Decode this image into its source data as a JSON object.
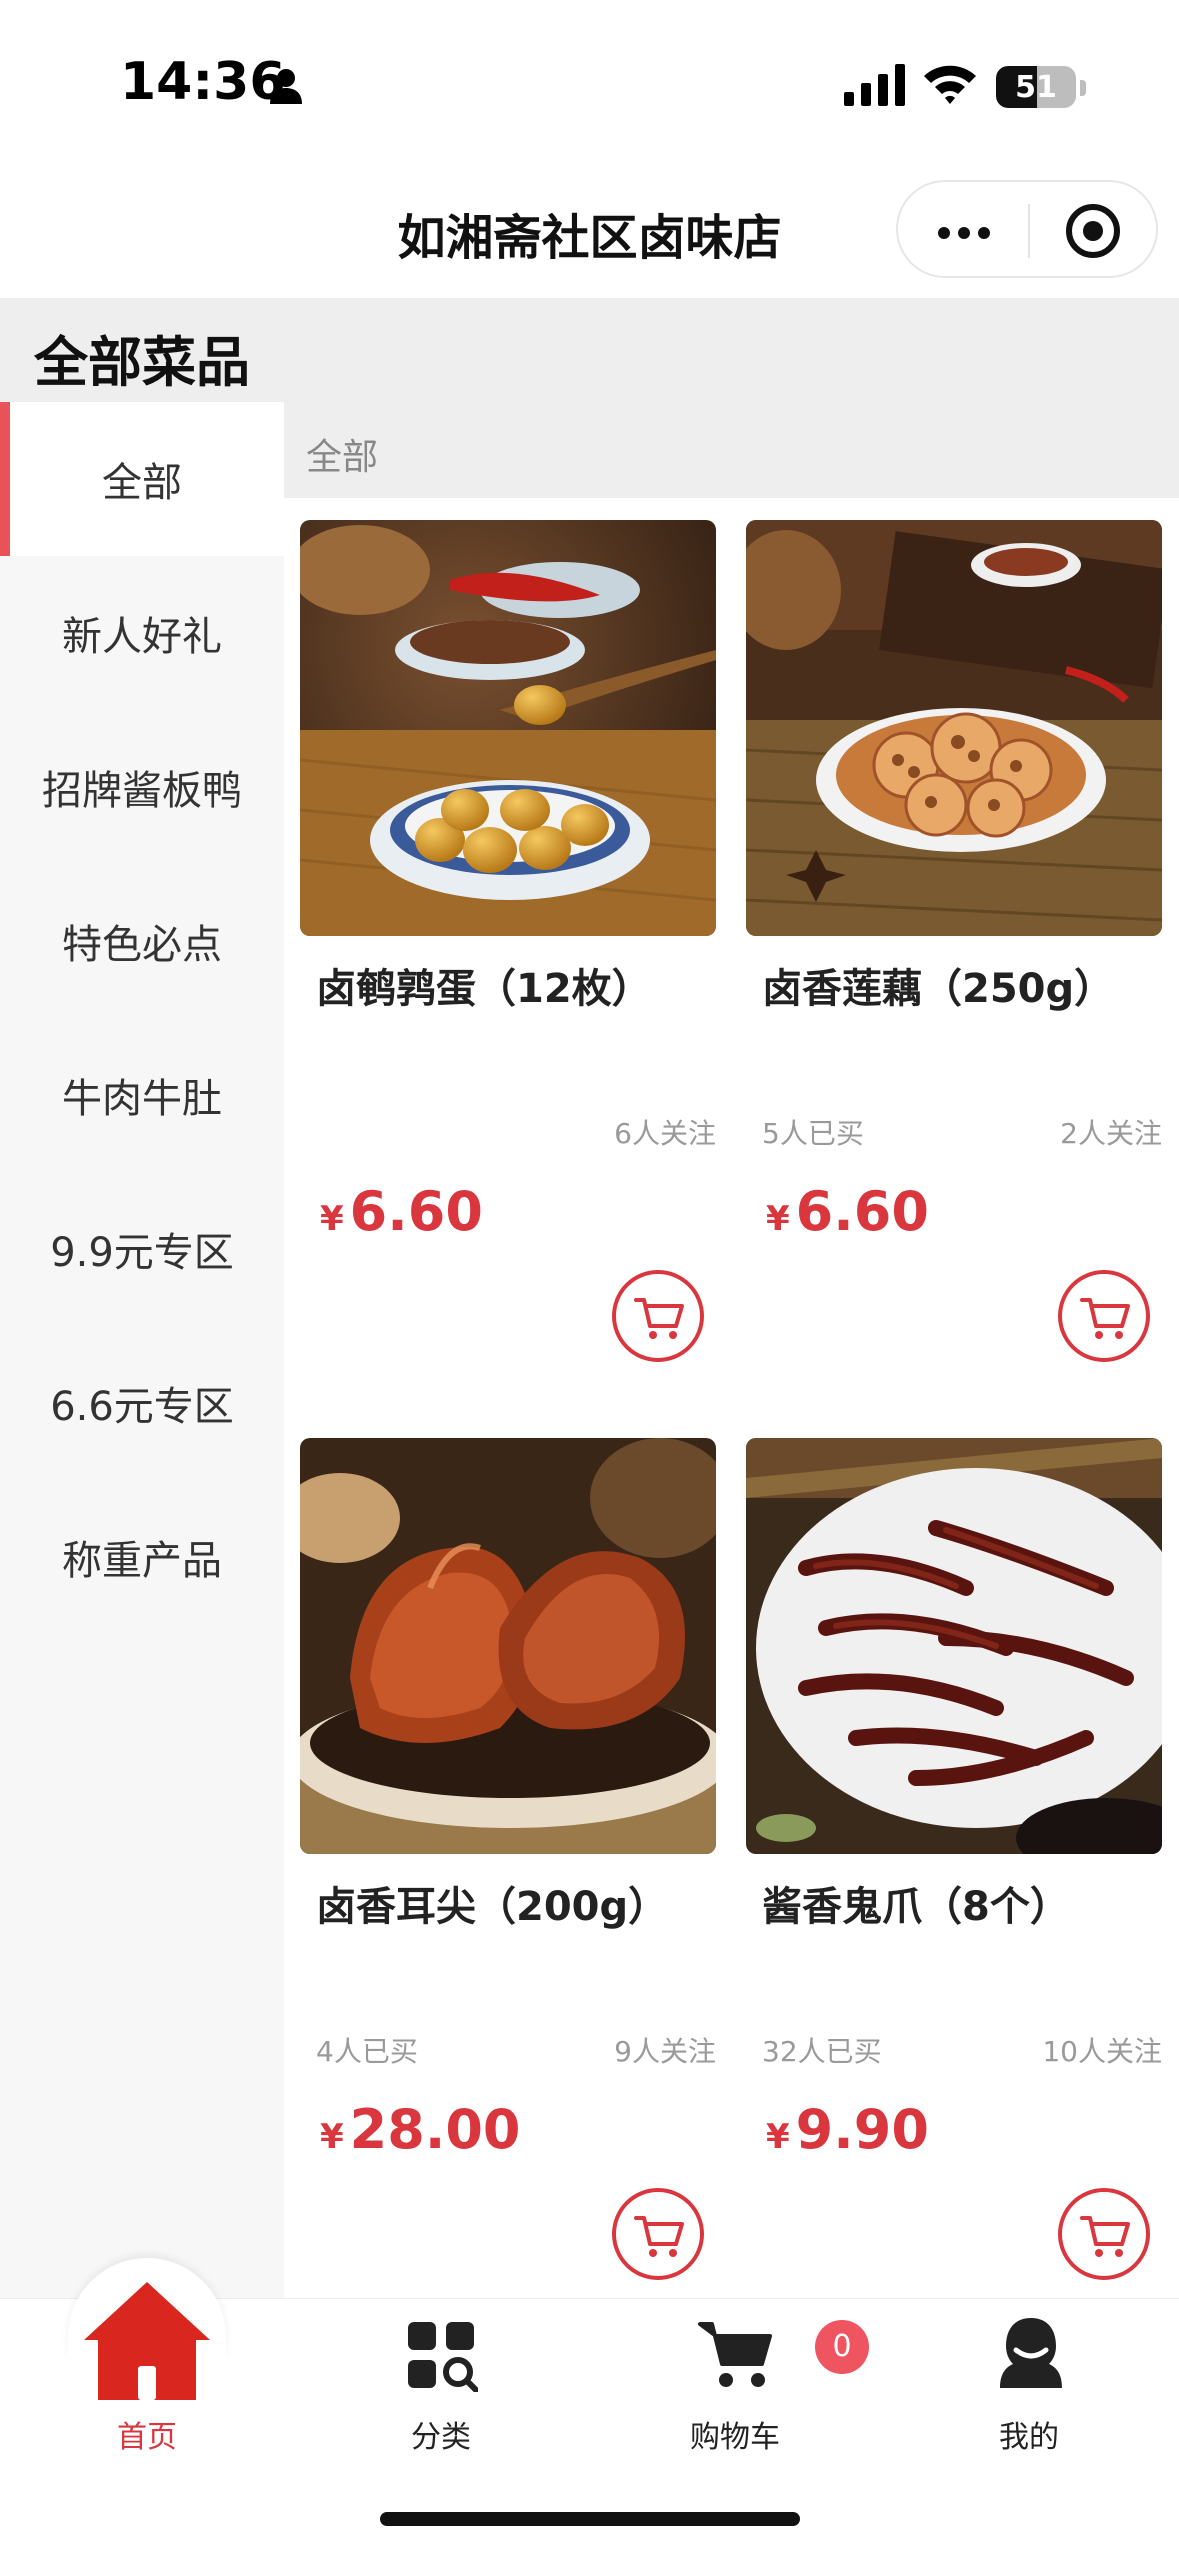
{
  "status_bar": {
    "time": "14:36",
    "battery": "51"
  },
  "nav": {
    "title": "如湘斋社区卤味店"
  },
  "section": {
    "title": "全部菜品"
  },
  "sidebar": {
    "items": [
      {
        "label": "全部",
        "active": true
      },
      {
        "label": "新人好礼"
      },
      {
        "label": "招牌酱板鸭"
      },
      {
        "label": "特色必点"
      },
      {
        "label": "牛肉牛肚"
      },
      {
        "label": "9.9元专区"
      },
      {
        "label": "6.6元专区"
      },
      {
        "label": "称重产品"
      }
    ]
  },
  "content": {
    "category_label": "全部",
    "products": [
      {
        "name": "卤鹌鹑蛋（12枚）",
        "bought": "",
        "follow": "6人关注",
        "currency": "¥",
        "price": "6.60",
        "image": "quail-eggs-image"
      },
      {
        "name": "卤香莲藕（250g）",
        "bought": "5人已买",
        "follow": "2人关注",
        "currency": "¥",
        "price": "6.60",
        "image": "lotus-root-image"
      },
      {
        "name": "卤香耳尖（200g）",
        "bought": "4人已买",
        "follow": "9人关注",
        "currency": "¥",
        "price": "28.00",
        "image": "pork-ear-image"
      },
      {
        "name": "酱香鬼爪（8个）",
        "bought": "32人已买",
        "follow": "10人关注",
        "currency": "¥",
        "price": "9.90",
        "image": "duck-claw-image"
      }
    ]
  },
  "tabbar": {
    "items": [
      {
        "label": "首页",
        "icon": "home-icon",
        "active": true
      },
      {
        "label": "分类",
        "icon": "category-icon"
      },
      {
        "label": "购物车",
        "icon": "cart-icon",
        "badge": "0"
      },
      {
        "label": "我的",
        "icon": "profile-icon"
      }
    ]
  },
  "colors": {
    "accent": "#d9363e",
    "badge": "#ef5560",
    "sidebar_bg": "#f7f7f7",
    "header_bg": "#eeeeee"
  }
}
